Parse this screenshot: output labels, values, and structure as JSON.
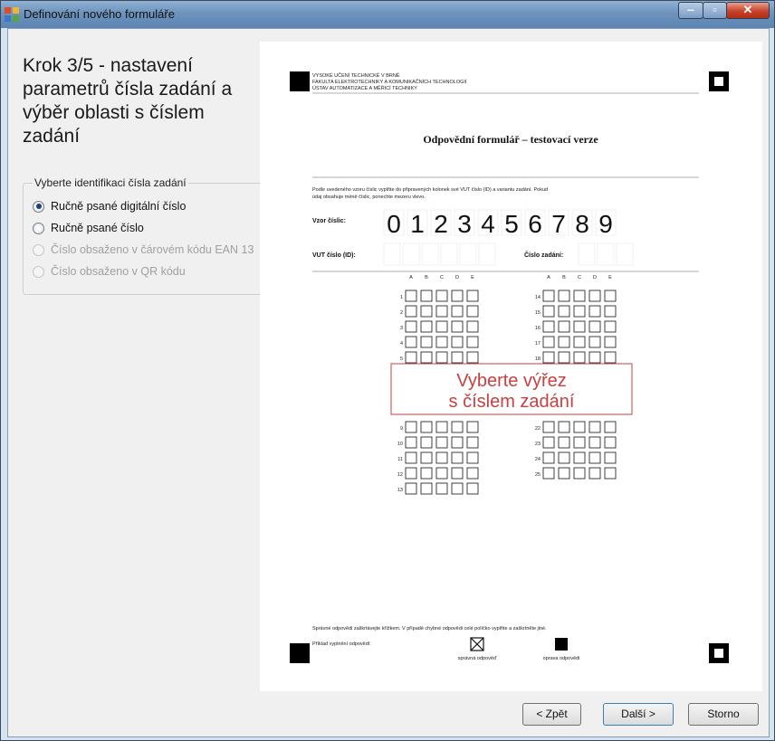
{
  "window": {
    "title": "Definování nového formuláře"
  },
  "left": {
    "heading": "Krok 3/5 - nastavení parametrů čísla zadání a výběr oblasti s číslem zadání",
    "group": {
      "legend": "Vyberte identifikaci čísla zadání",
      "options": [
        {
          "label": "Ručně psané digitální číslo",
          "checked": true,
          "enabled": true
        },
        {
          "label": "Ručně psané číslo",
          "checked": false,
          "enabled": true
        },
        {
          "label": "Číslo obsaženo v čárovém kódu EAN 13",
          "checked": false,
          "enabled": false
        },
        {
          "label": "Číslo obsaženo v QR kódu",
          "checked": false,
          "enabled": false
        }
      ]
    }
  },
  "form": {
    "header_lines": [
      "VYSOKÉ UČENÍ TECHNICKÉ V BRNĚ",
      "FAKULTA ELEKTROTECHNIKY A KOMUNIKAČNÍCH TECHNOLOGIÍ",
      "ÚSTAV AUTOMATIZACE A MĚŘICÍ TECHNIKY"
    ],
    "title": "Odpovědní formulář – testovací verze",
    "instructions_line1": "Podle uvedeného vzoru číslic vyplňte do připravených kolonek své VUT číslo (ID) a variantu zadání. Pokud",
    "instructions_line2": "údaj obsahuje méně číslic, ponechte mezeru vlevo.",
    "sample_label": "Vzor číslic:",
    "sample_digits": [
      "0",
      "1",
      "2",
      "3",
      "4",
      "5",
      "6",
      "7",
      "8",
      "9"
    ],
    "id_label": "VUT číslo (ID):",
    "variant_label": "Číslo zadání:",
    "answer_columns": [
      "A",
      "B",
      "C",
      "D",
      "E"
    ],
    "left_questions": [
      "1",
      "2",
      "3",
      "4",
      "5",
      "9",
      "10",
      "11",
      "12",
      "13"
    ],
    "right_questions": [
      "14",
      "15",
      "16",
      "17",
      "18",
      "22",
      "23",
      "24",
      "25"
    ],
    "selection_line1": "Vyberte výřez",
    "selection_line2": "s číslem zadání",
    "footer_instruction": "Správné odpovědi zaškrtávejte křížkem. V případě chybné odpovědi celé políčko vyplňte a zaškrtněte jiné.",
    "example_label": "Příklad vyplnění odpovědí:",
    "correct_label": "správná odpověď",
    "fix_label": "oprava odpovědi"
  },
  "buttons": {
    "back": "< Zpět",
    "next": "Další >",
    "cancel": "Storno"
  },
  "colors": {
    "selection": "#c84040",
    "window_border": "#6d93bd",
    "close": "#c5432a"
  }
}
